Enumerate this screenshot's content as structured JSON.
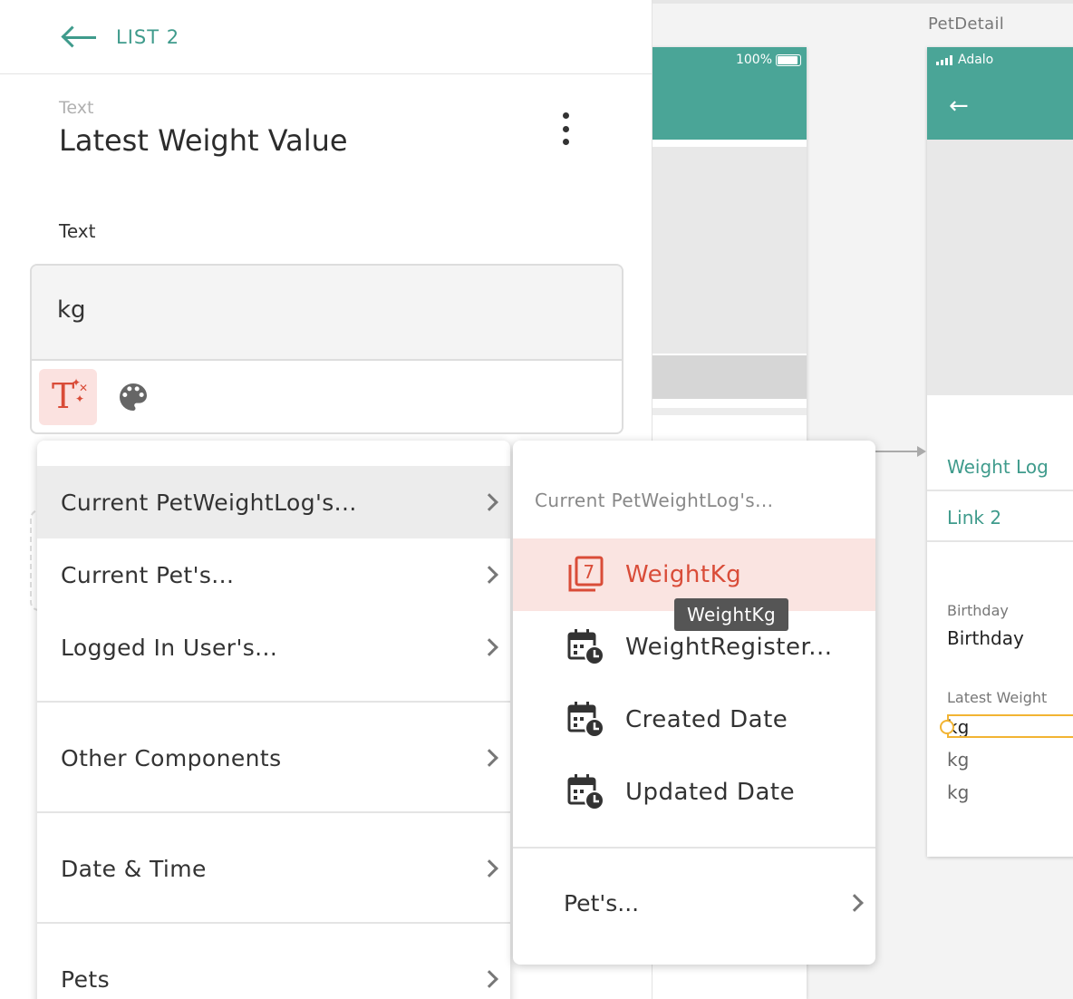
{
  "panel": {
    "back_label": "LIST 2",
    "component_type": "Text",
    "component_name": "Latest Weight Value",
    "field_label": "Text",
    "field_value": "kg"
  },
  "menu_primary": {
    "items": [
      {
        "label": "Current PetWeightLog's..."
      },
      {
        "label": "Current Pet's..."
      },
      {
        "label": "Logged In User's..."
      },
      {
        "label": "Other Components"
      },
      {
        "label": "Date & Time"
      },
      {
        "label": "Pets"
      }
    ]
  },
  "menu_secondary": {
    "header": "Current PetWeightLog's...",
    "items": [
      {
        "label": "WeightKg",
        "icon": "number-icon"
      },
      {
        "label": "WeightRegister...",
        "icon": "calendar-clock-icon"
      },
      {
        "label": "Created Date",
        "icon": "calendar-clock-icon"
      },
      {
        "label": "Updated Date",
        "icon": "calendar-clock-icon"
      }
    ],
    "sub_item": "Pet's...",
    "number_icon_digit": "7"
  },
  "tooltip": "WeightKg",
  "screen_list": {
    "battery_text": "100%"
  },
  "screen_detail": {
    "title": "PetDetail",
    "carrier": "Adalo",
    "rows": [
      "Weight Log",
      "Link 2"
    ],
    "birthday_label": "Birthday",
    "birthday_value": "Birthday",
    "latest_label": "Latest Weight",
    "kg_values": [
      "kg",
      "kg",
      "kg"
    ]
  },
  "colors": {
    "accent": "#4aa597",
    "link": "#3f9b8c",
    "highlight": "#d94c38",
    "highlight_bg": "#fae4e1",
    "selection": "#f2b433"
  }
}
